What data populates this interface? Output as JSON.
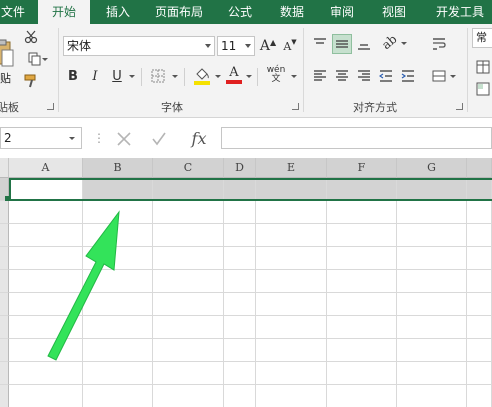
{
  "tabs": [
    "文件",
    "开始",
    "插入",
    "页面布局",
    "公式",
    "数据",
    "审阅",
    "视图",
    "开发工具"
  ],
  "active_tab": "开始",
  "clipboard": {
    "paste_label": "贴",
    "group_label": "贴板"
  },
  "font": {
    "name": "宋体",
    "size": "11",
    "group_label": "字体",
    "bold": "B",
    "italic": "I",
    "underline": "U",
    "grow": "A",
    "shrink": "A",
    "font_color_glyph": "A",
    "phonetic_glyph": "wén"
  },
  "alignment": {
    "group_label": "对齐方式"
  },
  "styles": {
    "partial_label": "常"
  },
  "formula_bar": {
    "name_box": "2",
    "fx": "fx"
  },
  "columns": [
    "A",
    "B",
    "C",
    "D",
    "E",
    "F",
    "G"
  ],
  "selection": {
    "columns": [
      "B",
      "C",
      "D",
      "E",
      "F",
      "G"
    ]
  },
  "colors": {
    "accent": "#217346",
    "arrow": "#33e35a",
    "fill_yellow": "#f5e100",
    "font_red": "#e02020"
  },
  "icons": {
    "arrow": "green-arrow-annotation"
  }
}
